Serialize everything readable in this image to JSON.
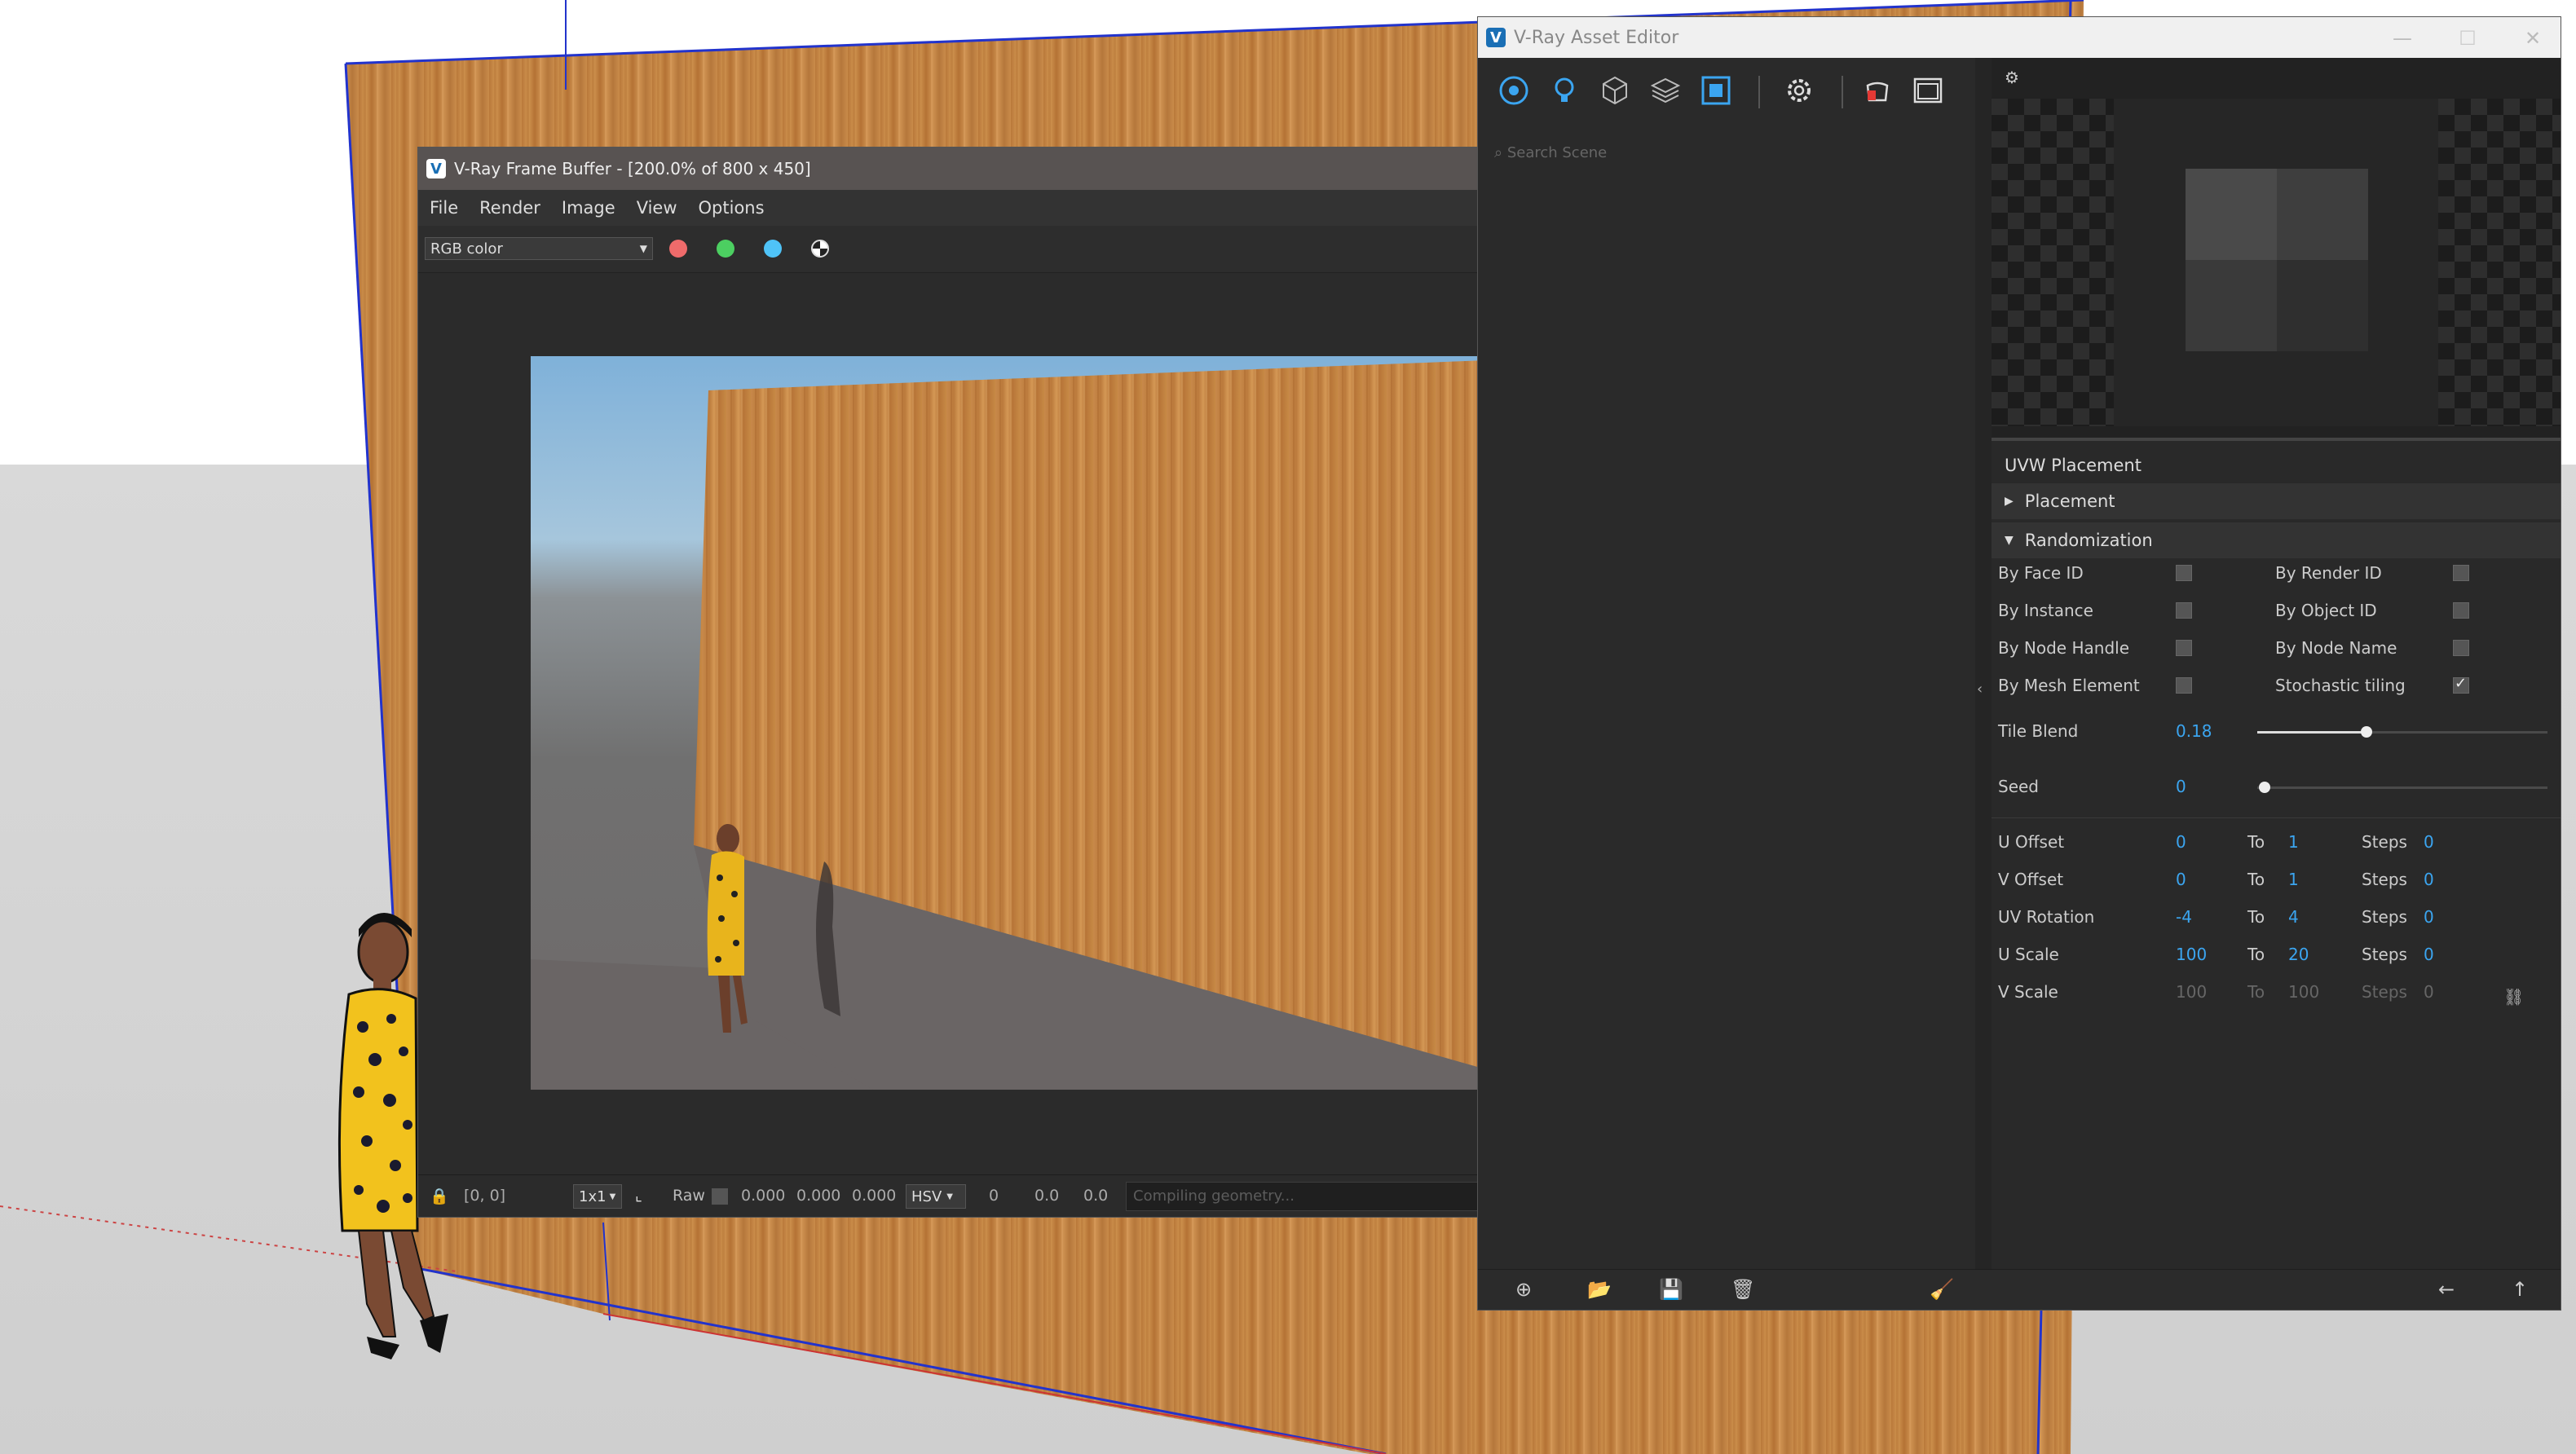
{
  "frame_buffer": {
    "title": "V-Ray Frame Buffer - [200.0% of 800 x 450]",
    "menu": [
      "File",
      "Render",
      "Image",
      "View",
      "Options"
    ],
    "channel": "RGB color",
    "status": {
      "coords": "[0, 0]",
      "ratio": "1x1",
      "mode": "Raw",
      "rgb": [
        "0.000",
        "0.000",
        "0.000"
      ],
      "color_space": "HSV",
      "hsv": [
        "0",
        "0.0",
        "0.0"
      ],
      "message": "Compiling geometry..."
    },
    "colors": {
      "red": "#ef6b6b",
      "green": "#4ccf61",
      "blue": "#4fc3f7"
    }
  },
  "asset_editor": {
    "title": "V-Ray Asset Editor",
    "search_placeholder": "Search Scene",
    "panel_title": "UVW Placement",
    "sections": {
      "placement": "Placement",
      "randomization": "Randomization"
    },
    "checks_left": [
      {
        "label": "By Face ID",
        "checked": false
      },
      {
        "label": "By Instance",
        "checked": false
      },
      {
        "label": "By Node Handle",
        "checked": false
      },
      {
        "label": "By Mesh Element",
        "checked": false
      }
    ],
    "checks_right": [
      {
        "label": "By Render ID",
        "checked": false
      },
      {
        "label": "By Object ID",
        "checked": false
      },
      {
        "label": "By Node Name",
        "checked": false
      },
      {
        "label": "Stochastic tiling",
        "checked": true
      }
    ],
    "tile_blend": {
      "label": "Tile Blend",
      "value": "0.18",
      "level": 0.18
    },
    "seed": {
      "label": "Seed",
      "value": "0",
      "level": 0
    },
    "to_label": "To",
    "steps_label": "Steps",
    "ranges": [
      {
        "label": "U Offset",
        "from": "0",
        "to": "1",
        "steps": "0",
        "enabled": true
      },
      {
        "label": "V Offset",
        "from": "0",
        "to": "1",
        "steps": "0",
        "enabled": true
      },
      {
        "label": "UV Rotation",
        "from": "-4",
        "to": "4",
        "steps": "0",
        "enabled": true
      },
      {
        "label": "U Scale",
        "from": "100",
        "to": "20",
        "steps": "0",
        "enabled": true
      },
      {
        "label": "V Scale",
        "from": "100",
        "to": "100",
        "steps": "0",
        "enabled": false
      }
    ]
  }
}
